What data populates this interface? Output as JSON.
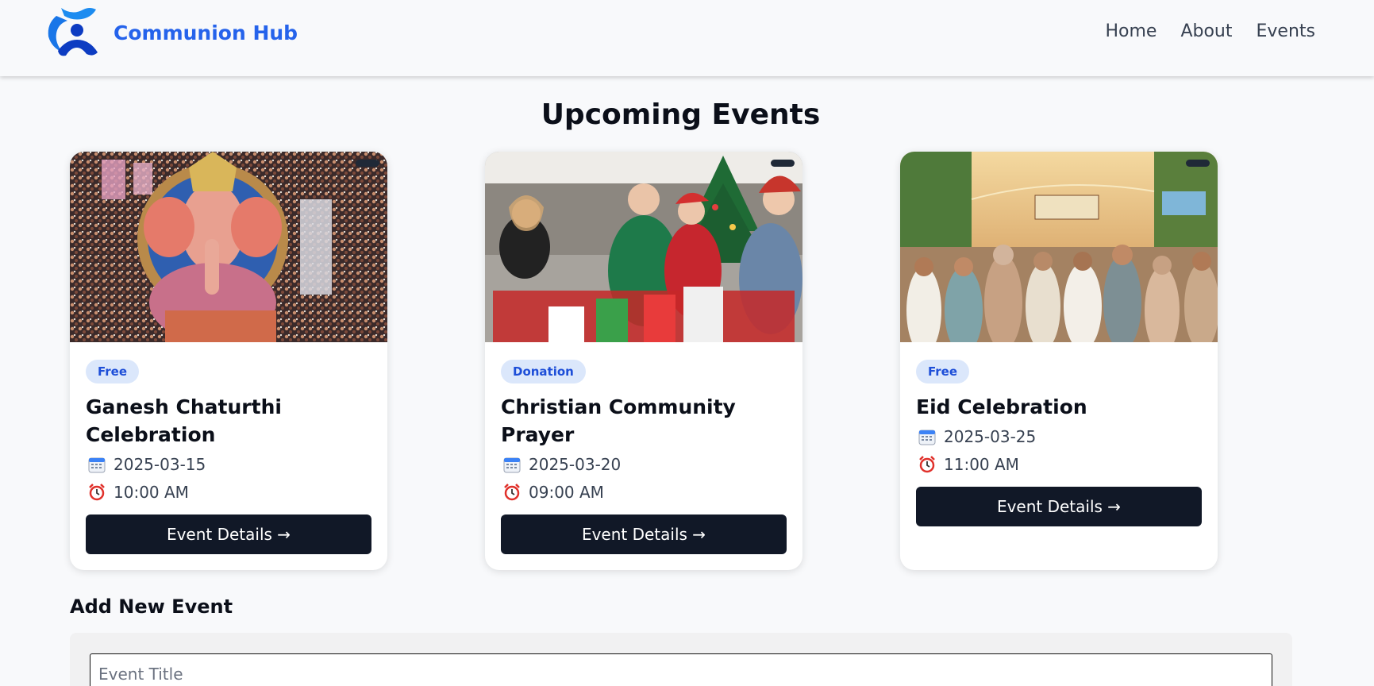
{
  "header": {
    "brand": "Communion Hub",
    "nav": [
      "Home",
      "About",
      "Events"
    ]
  },
  "page_title": "Upcoming Events",
  "events": [
    {
      "badge": "Free",
      "title": "Ganesh Chaturthi Celebration",
      "date": "2025-03-15",
      "time": "10:00 AM",
      "button": "Event Details →"
    },
    {
      "badge": "Donation",
      "title": "Christian Community Prayer",
      "date": "2025-03-20",
      "time": "09:00 AM",
      "button": "Event Details →"
    },
    {
      "badge": "Free",
      "title": "Eid Celebration",
      "date": "2025-03-25",
      "time": "11:00 AM",
      "button": "Event Details →"
    }
  ],
  "add_event": {
    "heading": "Add New Event",
    "title_placeholder": "Event Title"
  },
  "colors": {
    "brand": "#2563eb",
    "button_bg": "#111827",
    "badge_bg": "#dbe7fb",
    "badge_text": "#1d4ed8",
    "page_bg": "#f8f9fb"
  },
  "icons": [
    "communion-hub-logo",
    "calendar-icon",
    "alarm-clock-icon"
  ]
}
